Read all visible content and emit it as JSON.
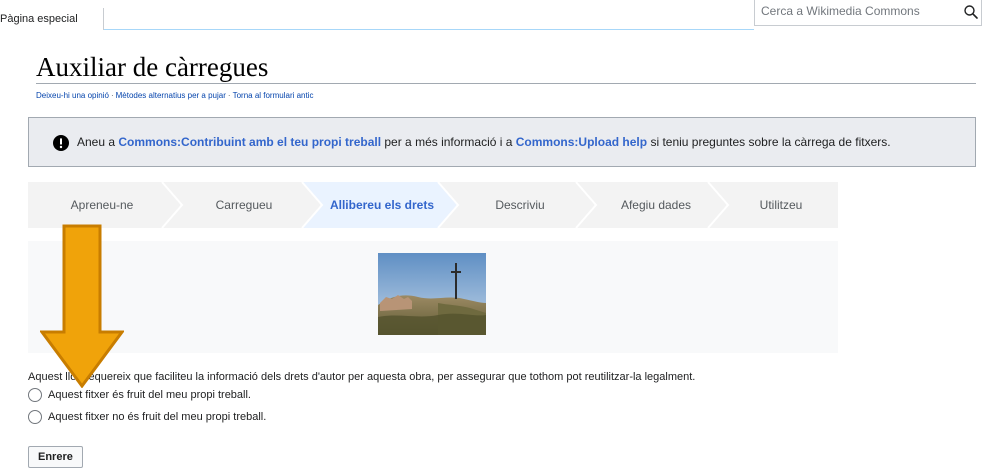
{
  "header": {
    "special_page_tab": "Pàgina especial",
    "search_placeholder": "Cerca a Wikimedia Commons",
    "search_icon": "search-icon"
  },
  "title": "Auxiliar de càrregues",
  "subnav": {
    "links": [
      "Deixeu-hi una opinió",
      "Mètodes alternatius per a pujar",
      "Torna al formulari antic"
    ],
    "separator": "·"
  },
  "notice": {
    "icon": "alert-icon",
    "text_1": "Aneu a ",
    "link_1": "Commons:Contribuint amb el teu propi treball",
    "text_2": " per a més informació i a ",
    "link_2": "Commons:Upload help",
    "text_3": " si teniu preguntes sobre la càrrega de fitxers."
  },
  "steps": [
    {
      "label": "Apreneu-ne",
      "active": false
    },
    {
      "label": "Carregueu",
      "active": false
    },
    {
      "label": "Allibereu els drets",
      "active": true
    },
    {
      "label": "Descriviu",
      "active": false
    },
    {
      "label": "Afegiu dades",
      "active": false
    },
    {
      "label": "Utilitzeu",
      "active": false
    }
  ],
  "intro_text": "Aquest lloc requereix que faciliteu la informació dels drets d'autor per aquesta obra, per assegurar que tothom pot reutilitzar-la legalment.",
  "options": [
    {
      "label": "Aquest fitxer és fruit del meu propi treball.",
      "checked": false
    },
    {
      "label": "Aquest fitxer no és fruit del meu propi treball.",
      "checked": false
    }
  ],
  "back_button": "Enrere",
  "colors": {
    "link": "#0645ad",
    "link_bold": "#3366cc",
    "active_step_bg": "#eaf3ff",
    "arrow_fill": "#f0a30a",
    "arrow_stroke": "#c87d00"
  }
}
